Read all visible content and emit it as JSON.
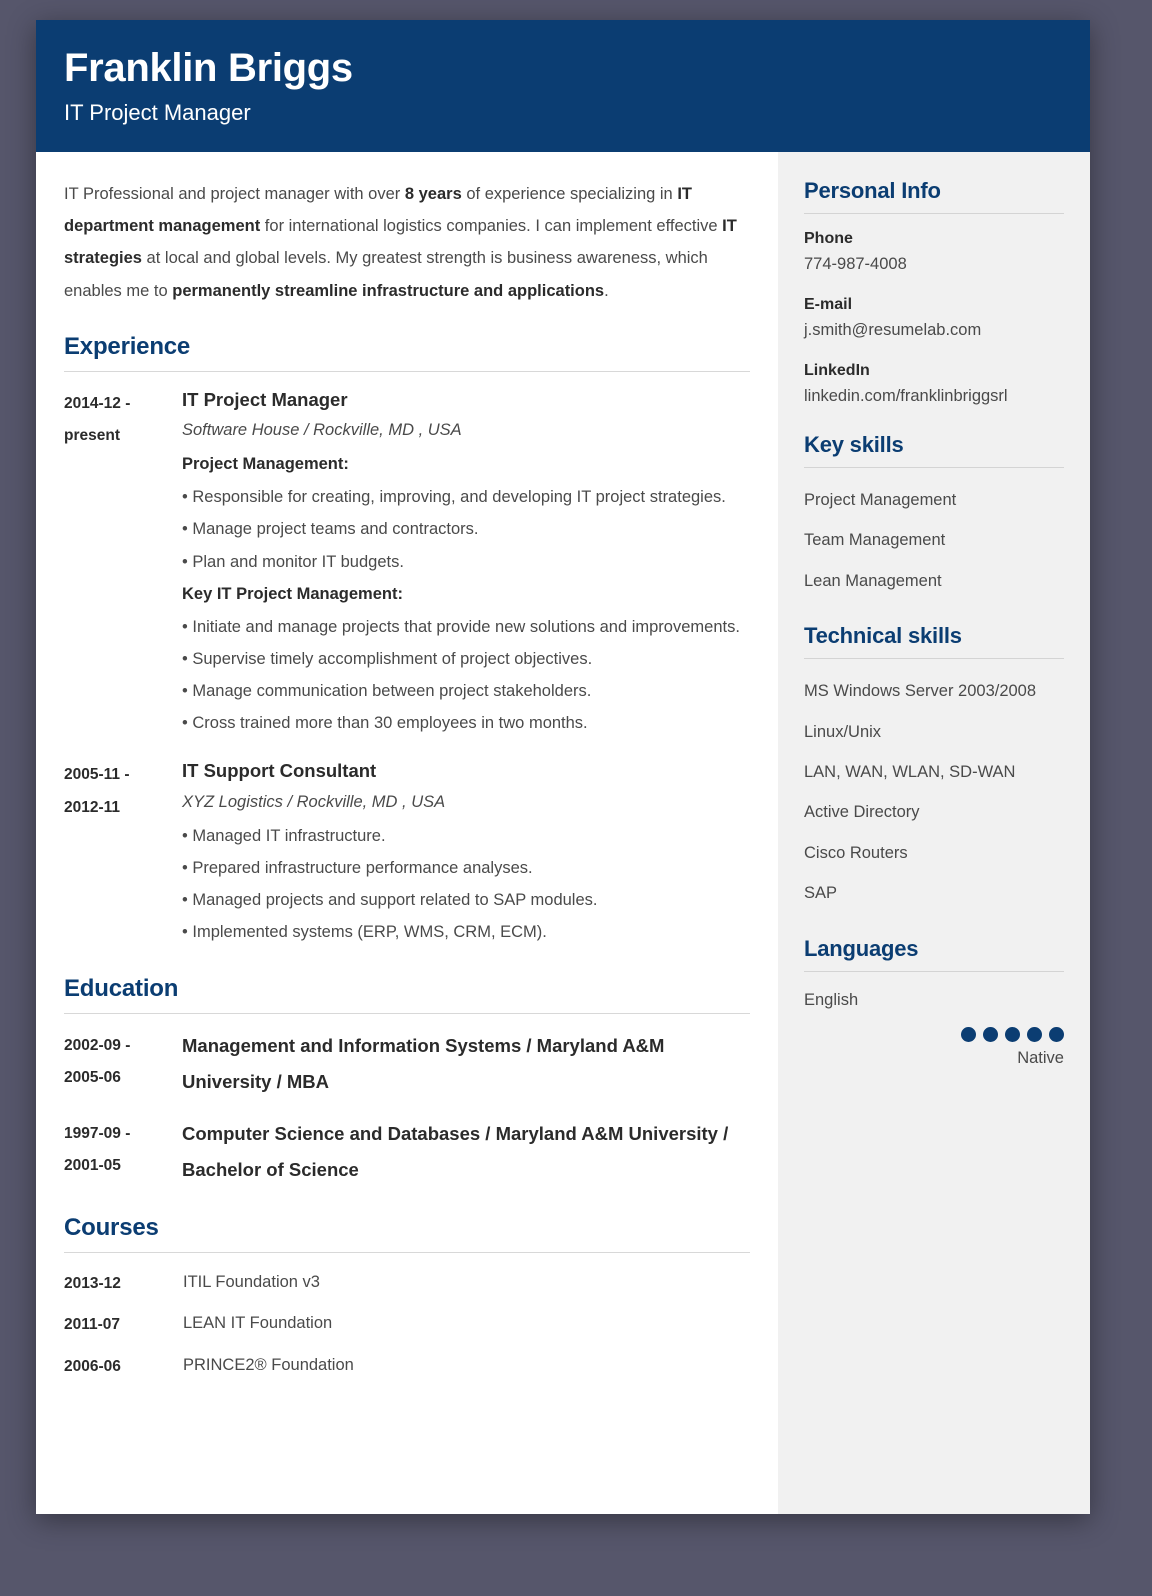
{
  "header": {
    "name": "Franklin Briggs",
    "job_title": "IT Project Manager",
    "background_color": "#0b3d72"
  },
  "summary": {
    "segments": [
      {
        "text": "IT Professional and project manager with over ",
        "bold": false
      },
      {
        "text": "8 years",
        "bold": true
      },
      {
        "text": " of experience specializing in ",
        "bold": false
      },
      {
        "text": "IT department management",
        "bold": true
      },
      {
        "text": " for international logistics companies. I can implement effective ",
        "bold": false
      },
      {
        "text": "IT strategies",
        "bold": true
      },
      {
        "text": " at local and global levels. My greatest strength is business awareness, which enables me to ",
        "bold": false
      },
      {
        "text": "permanently streamline infrastructure and applications",
        "bold": true
      },
      {
        "text": ".",
        "bold": false
      }
    ]
  },
  "experience": {
    "title": "Experience",
    "entries": [
      {
        "date_from": "2014-12 -",
        "date_to": "present",
        "role": "IT Project Manager",
        "company": "Software House / Rockville, MD , USA",
        "blocks": [
          {
            "heading": "Project Management:",
            "bullets": [
              "• Responsible for creating, improving, and developing IT project strategies.",
              "• Manage project teams and contractors.",
              "• Plan and monitor IT budgets."
            ]
          },
          {
            "heading": "Key IT Project Management:",
            "bullets": [
              "• Initiate and manage projects that provide new solutions and improvements.",
              "• Supervise timely accomplishment of project objectives.",
              "• Manage communication between project stakeholders.",
              "• Cross trained more than 30 employees in two months."
            ]
          }
        ]
      },
      {
        "date_from": "2005-11 -",
        "date_to": "2012-11",
        "role": "IT Support Consultant",
        "company": "XYZ Logistics / Rockville, MD , USA",
        "blocks": [
          {
            "heading": "",
            "bullets": [
              "• Managed IT infrastructure.",
              "• Prepared infrastructure performance analyses.",
              "• Managed projects and support related to SAP modules.",
              "• Implemented systems (ERP, WMS, CRM, ECM)."
            ]
          }
        ]
      }
    ]
  },
  "education": {
    "title": "Education",
    "entries": [
      {
        "date_from": "2002-09 -",
        "date_to": "2005-06",
        "degree": "Management and Information Systems / Maryland A&M University / MBA"
      },
      {
        "date_from": "1997-09 -",
        "date_to": "2001-05",
        "degree": "Computer Science and Databases / Maryland A&M University / Bachelor of Science"
      }
    ]
  },
  "courses": {
    "title": "Courses",
    "entries": [
      {
        "date": "2013-12",
        "name": "ITIL Foundation v3"
      },
      {
        "date": "2011-07",
        "name": "LEAN IT Foundation"
      },
      {
        "date": "2006-06",
        "name": "PRINCE2® Foundation"
      }
    ]
  },
  "sidebar": {
    "personal_info": {
      "title": "Personal Info",
      "fields": [
        {
          "label": "Phone",
          "value": "774-987-4008"
        },
        {
          "label": "E-mail",
          "value": "j.smith@resumelab.com"
        },
        {
          "label": "LinkedIn",
          "value": "linkedin.com/franklinbriggsrl"
        }
      ]
    },
    "key_skills": {
      "title": "Key skills",
      "items": [
        "Project Management",
        "Team Management",
        "Lean Management"
      ]
    },
    "technical_skills": {
      "title": "Technical skills",
      "items": [
        "MS Windows Server 2003/2008",
        "Linux/Unix",
        "LAN, WAN, WLAN, SD-WAN",
        "Active Directory",
        "Cisco Routers",
        "SAP"
      ]
    },
    "languages": {
      "title": "Languages",
      "items": [
        {
          "name": "English",
          "level": "Native",
          "rating": 5,
          "rating_max": 5
        }
      ]
    }
  },
  "theme": {
    "accent": "#0b3d72",
    "page_background": "#ffffff",
    "sidebar_background": "#f1f1f1",
    "outer_background": "#56566b"
  }
}
